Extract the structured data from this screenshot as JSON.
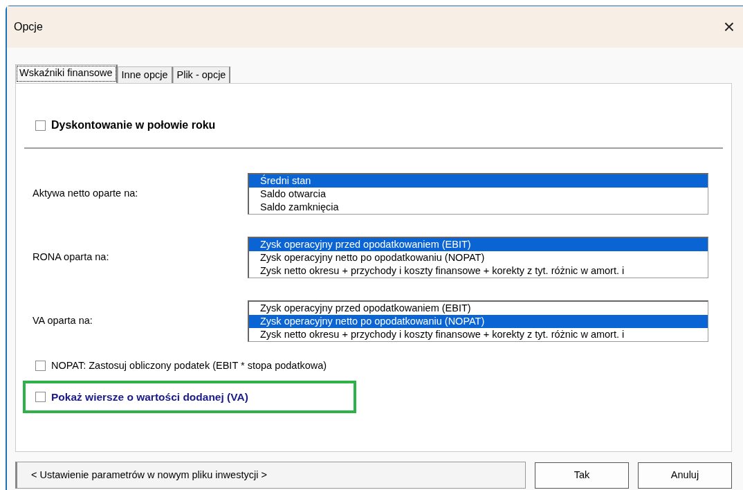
{
  "window": {
    "title": "Opcje",
    "close": "×"
  },
  "tabs": [
    {
      "label": "Wskaźniki finansowe",
      "selected": true
    },
    {
      "label": "Inne opcje",
      "selected": false
    },
    {
      "label": "Plik - opcje",
      "selected": false
    }
  ],
  "top_option": {
    "label": "Dyskontowanie w połowie roku",
    "checked": false
  },
  "lists": [
    {
      "label": "Aktywa netto oparte na:",
      "items": [
        {
          "text": "Średni stan",
          "selected": true
        },
        {
          "text": "Saldo otwarcia",
          "selected": false
        },
        {
          "text": "Saldo zamknięcia",
          "selected": false
        }
      ]
    },
    {
      "label": "RONA oparta na:",
      "items": [
        {
          "text": "Zysk operacyjny przed opodatkowaniem (EBIT)",
          "selected": true
        },
        {
          "text": "Zysk operacyjny netto po opodatkowaniu (NOPAT)",
          "selected": false
        },
        {
          "text": "Zysk netto okresu + przychody i koszty finansowe + korekty z tyt. różnic w amort. i",
          "selected": false
        }
      ]
    },
    {
      "label": "VA oparta na:",
      "items": [
        {
          "text": "Zysk operacyjny przed opodatkowaniem (EBIT)",
          "selected": false
        },
        {
          "text": "Zysk operacyjny netto po opodatkowaniu (NOPAT)",
          "selected": true
        },
        {
          "text": "Zysk netto okresu + przychody i koszty finansowe + korekty z tyt. różnic w amort. i",
          "selected": false
        }
      ]
    }
  ],
  "options": [
    {
      "label": "NOPAT: Zastosuj obliczony podatek (EBIT * stopa podatkowa)",
      "checked": false,
      "kind": "plain",
      "highlighted": false
    },
    {
      "label": "Pokaż wiersze o wartości dodanej (VA)",
      "checked": false,
      "kind": "emphasis",
      "highlighted": true
    }
  ],
  "status_field": "< Ustawienie parametrów w nowym pliku inwestycji >",
  "buttons": [
    "Tak",
    "Anuluj"
  ]
}
